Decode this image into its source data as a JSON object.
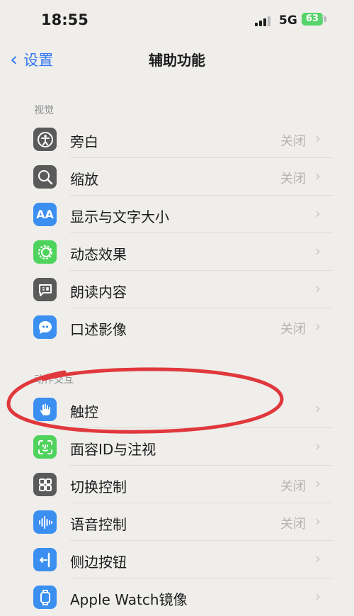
{
  "status_bar": {
    "time": "18:55",
    "network": "5G",
    "battery": "63"
  },
  "nav": {
    "back_label": "设置",
    "title": "辅助功能"
  },
  "sections": [
    {
      "label": "视觉",
      "items": [
        {
          "label": "旁白",
          "value": "关闭",
          "icon": "voiceover-icon",
          "color": "#5a5a5a"
        },
        {
          "label": "缩放",
          "value": "关闭",
          "icon": "zoom-icon",
          "color": "#5a5a5a"
        },
        {
          "label": "显示与文字大小",
          "value": "",
          "icon": "text-size-icon",
          "color": "#3b8ff0"
        },
        {
          "label": "动态效果",
          "value": "",
          "icon": "motion-icon",
          "color": "#4ed35c"
        },
        {
          "label": "朗读内容",
          "value": "",
          "icon": "spoken-content-icon",
          "color": "#5a5a5a"
        },
        {
          "label": "口述影像",
          "value": "关闭",
          "icon": "audio-description-icon",
          "color": "#3b8ff0"
        }
      ]
    },
    {
      "label": "动作交互",
      "items": [
        {
          "label": "触控",
          "value": "",
          "icon": "touch-icon",
          "color": "#3b8ff0"
        },
        {
          "label": "面容ID与注视",
          "value": "",
          "icon": "face-id-icon",
          "color": "#4ed35c"
        },
        {
          "label": "切换控制",
          "value": "关闭",
          "icon": "switch-control-icon",
          "color": "#5a5a5a"
        },
        {
          "label": "语音控制",
          "value": "关闭",
          "icon": "voice-control-icon",
          "color": "#3b8ff0"
        },
        {
          "label": "侧边按钮",
          "value": "",
          "icon": "side-button-icon",
          "color": "#3b8ff0"
        },
        {
          "label": "Apple Watch镜像",
          "value": "",
          "icon": "apple-watch-icon",
          "color": "#3b8ff0"
        }
      ]
    }
  ],
  "colors": {
    "accent": "#3478f6",
    "annotation": "#e0383c"
  }
}
